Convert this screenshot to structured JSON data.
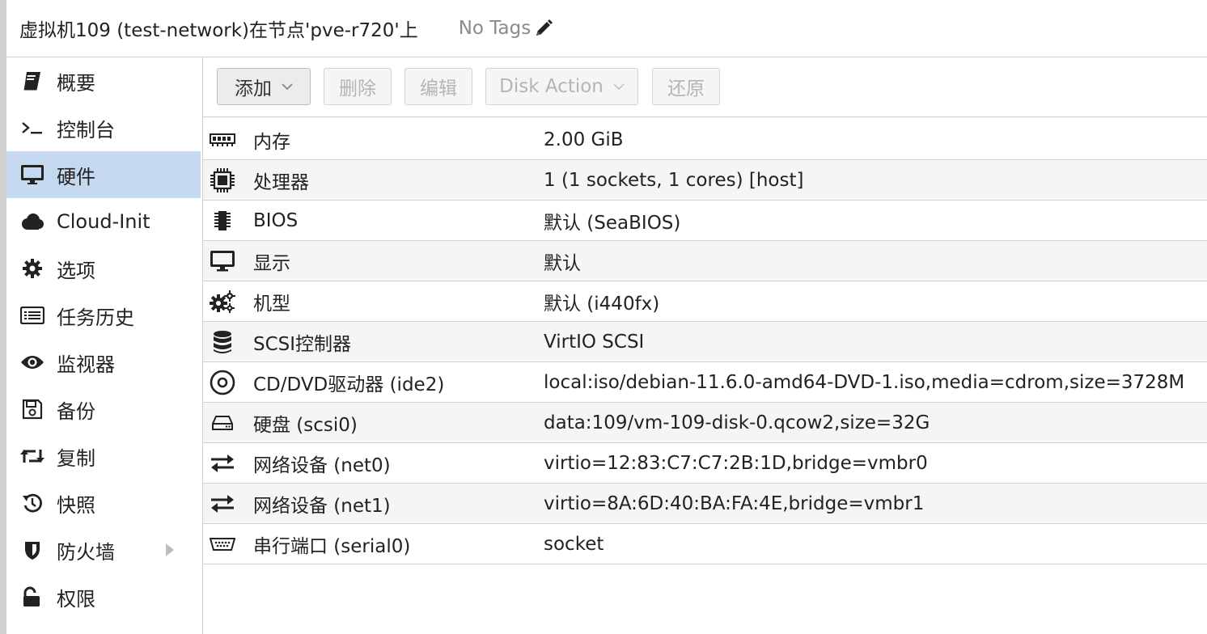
{
  "header": {
    "title": "虚拟机109 (test-network)在节点'pve-r720'上",
    "tags_label": "No Tags",
    "tags_icon": "pencil-icon"
  },
  "sidebar": {
    "items": [
      {
        "label": "概要",
        "icon": "book-icon"
      },
      {
        "label": "控制台",
        "icon": "terminal-icon"
      },
      {
        "label": "硬件",
        "icon": "desktop-icon",
        "active": true
      },
      {
        "label": "Cloud-Init",
        "icon": "cloud-icon"
      },
      {
        "label": "选项",
        "icon": "gear-icon"
      },
      {
        "label": "任务历史",
        "icon": "list-icon"
      },
      {
        "label": "监视器",
        "icon": "eye-icon"
      },
      {
        "label": "备份",
        "icon": "floppy-icon"
      },
      {
        "label": "复制",
        "icon": "retweet-icon"
      },
      {
        "label": "快照",
        "icon": "history-icon"
      },
      {
        "label": "防火墙",
        "icon": "shield-icon",
        "has_submenu": true
      },
      {
        "label": "权限",
        "icon": "unlock-icon"
      }
    ]
  },
  "toolbar": {
    "add": "添加",
    "remove": "删除",
    "edit": "编辑",
    "disk_action": "Disk Action",
    "revert": "还原"
  },
  "hardware": [
    {
      "name": "内存",
      "value": "2.00 GiB",
      "icon": "memory-icon"
    },
    {
      "name": "处理器",
      "value": "1 (1 sockets, 1 cores) [host]",
      "icon": "cpu-icon"
    },
    {
      "name": "BIOS",
      "value": "默认 (SeaBIOS)",
      "icon": "chip-icon"
    },
    {
      "name": "显示",
      "value": "默认",
      "icon": "desktop-icon"
    },
    {
      "name": "机型",
      "value": "默认 (i440fx)",
      "icon": "cogs-icon"
    },
    {
      "name": "SCSI控制器",
      "value": "VirtIO SCSI",
      "icon": "database-icon"
    },
    {
      "name": "CD/DVD驱动器 (ide2)",
      "value": "local:iso/debian-11.6.0-amd64-DVD-1.iso,media=cdrom,size=3728M",
      "icon": "cdrom-icon"
    },
    {
      "name": "硬盘 (scsi0)",
      "value": "data:109/vm-109-disk-0.qcow2,size=32G",
      "icon": "hdd-icon"
    },
    {
      "name": "网络设备 (net0)",
      "value": "virtio=12:83:C7:C7:2B:1D,bridge=vmbr0",
      "icon": "exchange-icon"
    },
    {
      "name": "网络设备 (net1)",
      "value": "virtio=8A:6D:40:BA:FA:4E,bridge=vmbr1",
      "icon": "exchange-icon"
    },
    {
      "name": "串行端口 (serial0)",
      "value": "socket",
      "icon": "serial-port-icon"
    }
  ]
}
